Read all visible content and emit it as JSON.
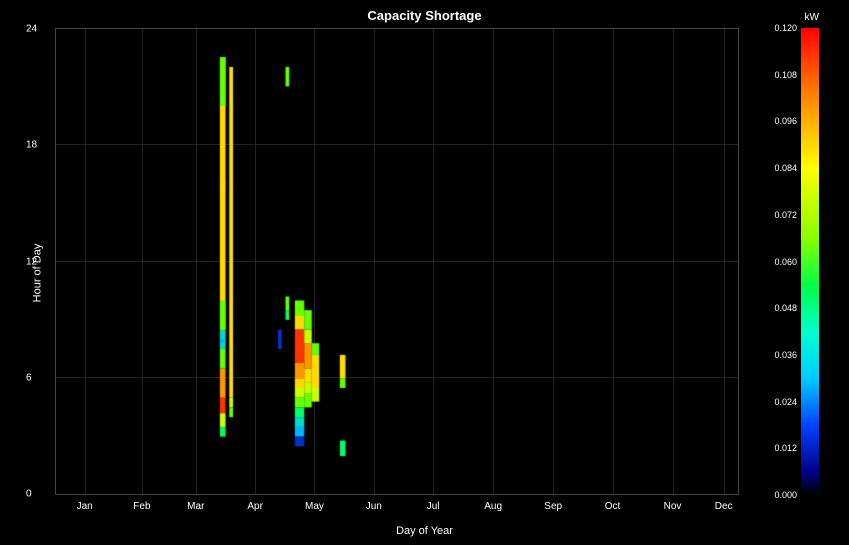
{
  "title": "Capacity Shortage",
  "yAxisLabel": "Hour of Day",
  "xAxisLabel": "Day of Year",
  "colorbarUnit": "kW",
  "yTicks": [
    {
      "value": 0,
      "pct": 100
    },
    {
      "value": 6,
      "pct": 75
    },
    {
      "value": 12,
      "pct": 50
    },
    {
      "value": 18,
      "pct": 25
    },
    {
      "value": 24,
      "pct": 0
    }
  ],
  "xTicks": [
    {
      "label": "Jan",
      "pct": 4.2
    },
    {
      "label": "Feb",
      "pct": 12.6
    },
    {
      "label": "Mar",
      "pct": 20.5
    },
    {
      "label": "Apr",
      "pct": 29.2
    },
    {
      "label": "May",
      "pct": 37.9
    },
    {
      "label": "Jun",
      "pct": 46.6
    },
    {
      "label": "Jul",
      "pct": 55.3
    },
    {
      "label": "Aug",
      "pct": 64.1
    },
    {
      "label": "Sep",
      "pct": 72.9
    },
    {
      "label": "Oct",
      "pct": 81.6
    },
    {
      "label": "Nov",
      "pct": 90.4
    },
    {
      "label": "Dec",
      "pct": 97.9
    }
  ],
  "colorbarTicks": [
    {
      "value": "0.120",
      "pct": 0
    },
    {
      "value": "0.108",
      "pct": 10
    },
    {
      "value": "0.096",
      "pct": 20
    },
    {
      "value": "0.084",
      "pct": 30
    },
    {
      "value": "0.072",
      "pct": 40
    },
    {
      "value": "0.060",
      "pct": 50
    },
    {
      "value": "0.048",
      "pct": 60
    },
    {
      "value": "0.036",
      "pct": 70
    },
    {
      "value": "0.024",
      "pct": 80
    },
    {
      "value": "0.012",
      "pct": 90
    },
    {
      "value": "0.000",
      "pct": 100
    }
  ]
}
